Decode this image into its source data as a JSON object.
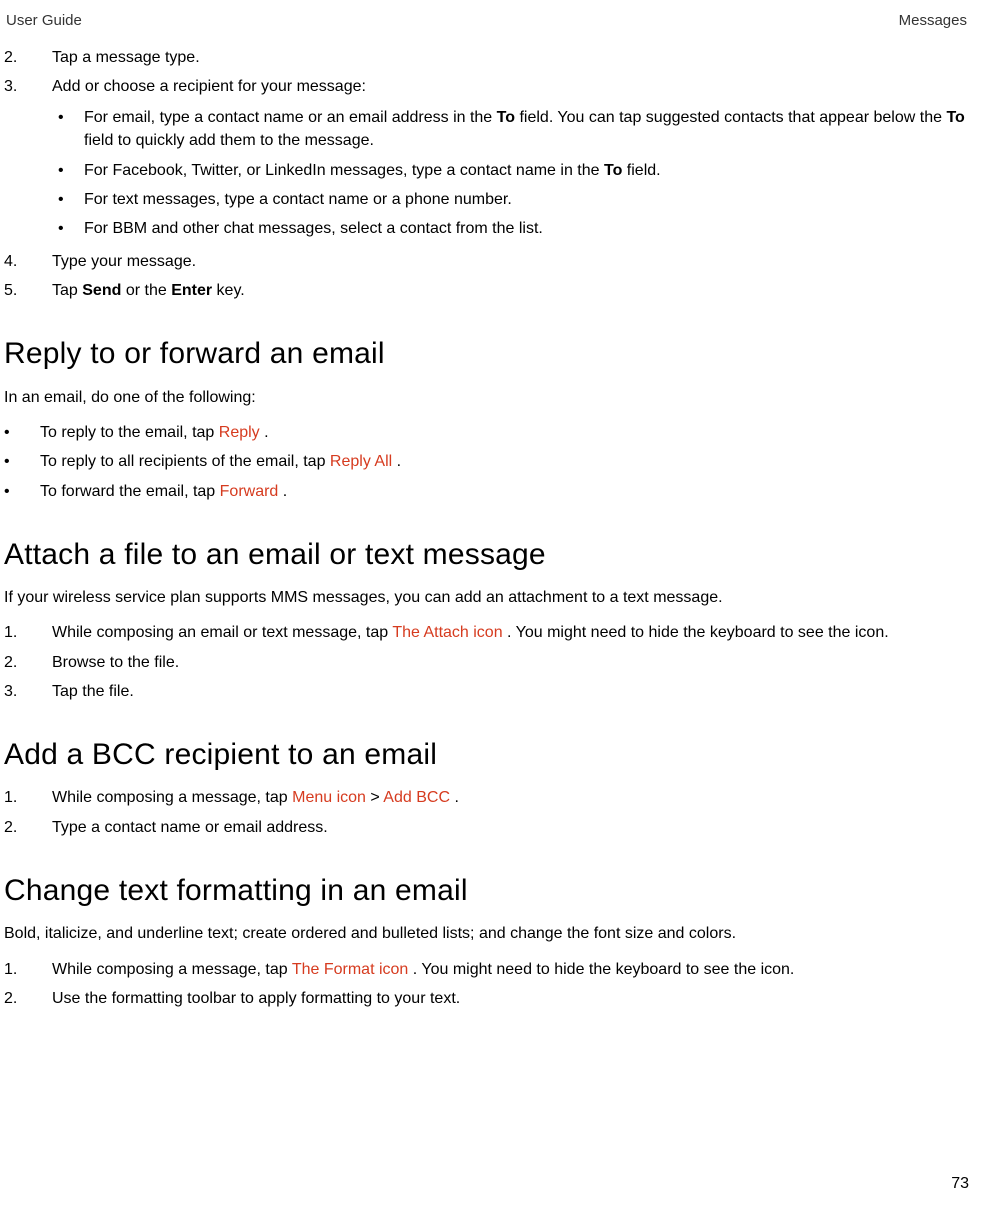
{
  "header": {
    "left": "User Guide",
    "right": "Messages"
  },
  "page_number": "73",
  "intro_steps": {
    "s2": "Tap a message type.",
    "s3": "Add or choose a recipient for your message:",
    "sub": {
      "b1a": "For email, type a contact name or an email address in the ",
      "b1_to": "To",
      "b1b": " field. You can tap suggested contacts that appear below the ",
      "b1_to2": "To",
      "b1c": " field to quickly add them to the message.",
      "b2a": "For Facebook, Twitter, or LinkedIn messages, type a contact name in the ",
      "b2_to": "To",
      "b2b": " field.",
      "b3": "For text messages, type a contact name or a phone number.",
      "b4": "For BBM and other chat messages, select a contact from the list."
    },
    "s4": "Type your message.",
    "s5a": "Tap ",
    "s5_send": "Send",
    "s5b": " or the ",
    "s5_enter": "Enter",
    "s5c": " key."
  },
  "reply": {
    "heading": "Reply to or forward an email",
    "lead": "In an email, do one of the following:",
    "b1a": "To reply to the email, tap ",
    "b1_icon": " Reply ",
    "b1b": ".",
    "b2a": "To reply to all recipients of the email, tap ",
    "b2_icon": " Reply All ",
    "b2b": ".",
    "b3a": "To forward the email, tap ",
    "b3_icon": " Forward ",
    "b3b": "."
  },
  "attach": {
    "heading": "Attach a file to an email or text message",
    "lead": "If your wireless service plan supports MMS messages, you can add an attachment to a text message.",
    "s1a": "While composing an email or text message, tap ",
    "s1_icon": " The Attach icon ",
    "s1b": ". You might need to hide the keyboard to see the icon.",
    "s2": "Browse to the file.",
    "s3": "Tap the file."
  },
  "bcc": {
    "heading": "Add a BCC recipient to an email",
    "s1a": "While composing a message, tap ",
    "s1_icon1": " Menu icon ",
    "s1_sep": " > ",
    "s1_icon2": " Add BCC ",
    "s1b": ".",
    "s2": "Type a contact name or email address."
  },
  "format": {
    "heading": "Change text formatting in an email",
    "lead": "Bold, italicize, and underline text; create ordered and bulleted lists; and change the font size and colors.",
    "s1a": "While composing a message, tap ",
    "s1_icon": " The Format icon ",
    "s1b": ". You might need to hide the keyboard to see the icon.",
    "s2": "Use the formatting toolbar to apply formatting to your text."
  }
}
